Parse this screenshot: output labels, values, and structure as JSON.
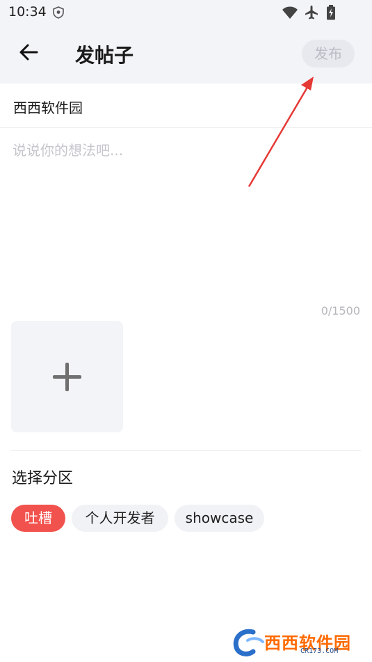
{
  "status_bar": {
    "time": "10:34",
    "icons": [
      "shield-icon",
      "wifi-icon",
      "airplane-icon",
      "battery-charging-icon"
    ]
  },
  "header": {
    "title": "发帖子",
    "publish_label": "发布",
    "back_icon": "back-arrow-icon"
  },
  "forum": {
    "name": "西西软件园"
  },
  "composer": {
    "placeholder": "说说你的想法吧...",
    "value": "",
    "counter": "0/1500"
  },
  "image_picker": {
    "icon": "plus-icon"
  },
  "category": {
    "title": "选择分区",
    "tags": [
      {
        "label": "吐槽",
        "selected": true
      },
      {
        "label": "个人开发者",
        "selected": false
      },
      {
        "label": "showcase",
        "selected": false
      }
    ]
  },
  "colors": {
    "accent": "#f2524d",
    "header_bg": "#f3f4f8",
    "annotation_arrow": "#e53935"
  },
  "watermark": {
    "main": "西西软件园",
    "sub": "CR173.COM"
  }
}
